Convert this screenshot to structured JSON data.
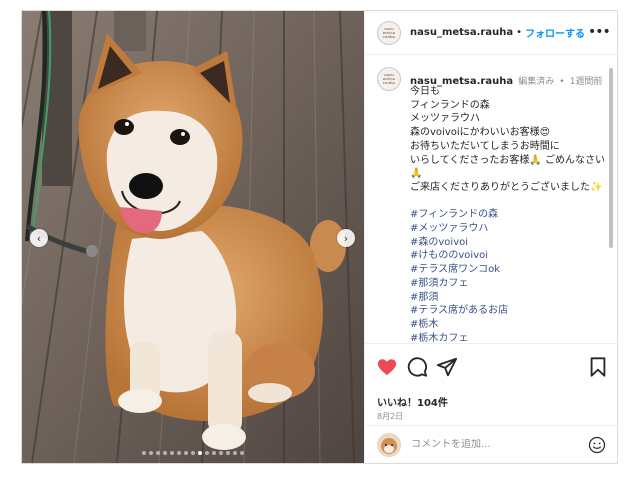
{
  "post": {
    "username": "nasu_metsa.rauha",
    "header_separator": "•",
    "follow_label": "フォローする",
    "more_label": "•••",
    "avatar_text": "nasu metsa rauha",
    "photo_alt": "柴犬",
    "carousel": {
      "prev_label": "‹",
      "next_label": "›",
      "dot_count": 15,
      "active_index": 8
    }
  },
  "caption": {
    "username": "nasu_metsa.rauha",
    "edited": "編集済み",
    "separator": "•",
    "time_ago": "1週間前",
    "lines": [
      "今日も",
      "フィンランドの森",
      "メッツァラウハ",
      "森のvoivoiにかわいいお客様😍",
      "お待ちいただいてしまうお時間に",
      "いらしてくださったお客様🙏 ごめんなさい🙏",
      "ご来店くださりありがとうございました✨",
      ""
    ],
    "hashtags": [
      "#フィンランドの森",
      "#メッツァラウハ",
      "#森のvoivoi",
      "#けもののvoivoi",
      "#テラス席ワンコok",
      "#那須カフェ",
      "#那須",
      "#テラス席があるお店",
      "#栃木",
      "#栃木カフェ"
    ]
  },
  "actions": {
    "likes_text": "いいね！104件",
    "date_text": "8月2日",
    "icons": [
      "heart-icon",
      "comment-icon",
      "share-icon",
      "bookmark-icon"
    ],
    "like_color": "#ed4956"
  },
  "comment": {
    "placeholder": "コメントを追加...",
    "emoji_icon": "smiley-icon"
  },
  "colors": {
    "accent": "#0095f6",
    "hashtag": "#385185",
    "meta": "#8e8e8e",
    "border": "#dbdbdb"
  }
}
